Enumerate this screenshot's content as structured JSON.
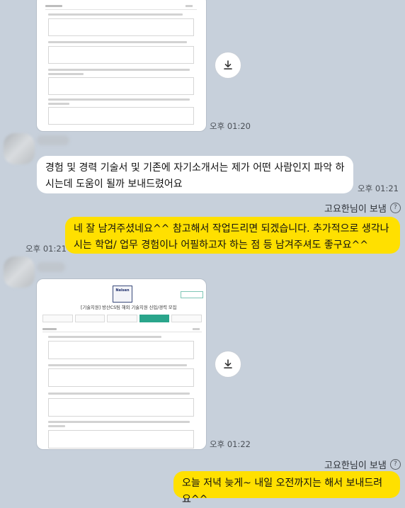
{
  "messages": {
    "time_1": "오후 01:20",
    "incoming_text": "경험 및 경력 기술서 및 기존에 자기소개서는 제가 어떤 사람인지 파악 하시는데 도움이 될까 보내드렸어요",
    "time_2": "오후 01:21",
    "sender_1": "고요한님이 보냄",
    "outgoing_text_1": "네 잘 남겨주셨네요^^ 참고해서 작업드리면 되겠습니다. 추가적으로 생각나시는 학업/ 업무 경험이나 어필하고자 하는 점 등 남겨주셔도 좋구요^^",
    "time_3": "오후 01:21",
    "time_4": "오후 01:22",
    "sender_2": "고요한님이 보냄",
    "outgoing_text_2": "오늘 저녁 늦게~ 내일 오전까지는 해서 보내드려요^^"
  },
  "preview_2": {
    "logo_text": "Nelsen",
    "title": "[기술지원] 방산CS팀 해외 기술지원 신입/경력 모집"
  },
  "icons": {
    "download": "download-icon",
    "help": "question-circle-icon"
  },
  "colors": {
    "background": "#c7d0db",
    "outgoing_bubble": "#ffe000",
    "incoming_bubble": "#ffffff",
    "accent_tab": "#2aa58b"
  }
}
